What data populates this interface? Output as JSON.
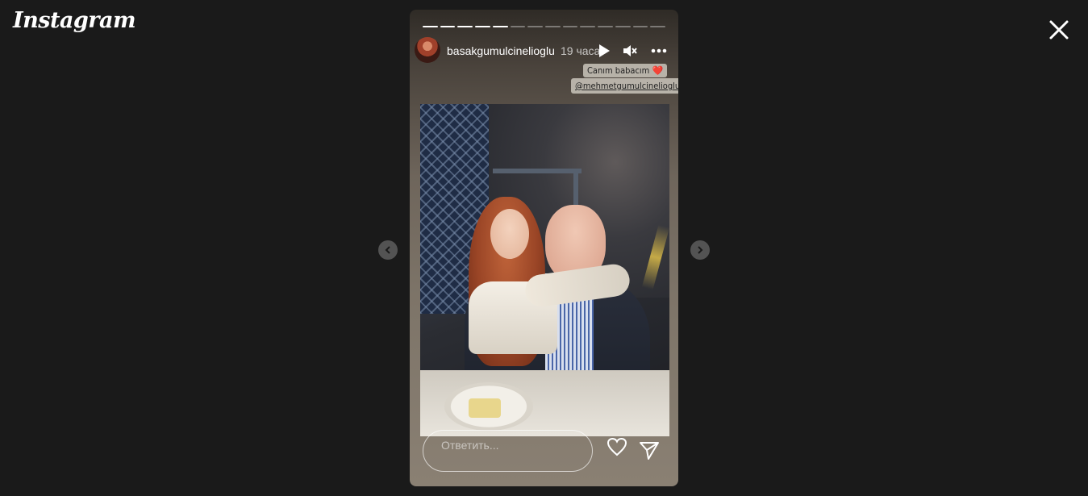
{
  "app": {
    "logo_text": "Instagram"
  },
  "story": {
    "progress": {
      "total_segments": 14,
      "completed_segments": 5
    },
    "author": {
      "username": "basakgumulcinelioglu",
      "time_ago": "19 часа"
    },
    "controls": {
      "play_icon": "play-icon",
      "mute_icon": "muted-speaker-icon",
      "more_icon": "more-dots-icon"
    },
    "caption": {
      "line1": "Canım babacım ❤️",
      "mention": "@mehmetgumulcinelioglu"
    },
    "reply": {
      "placeholder": "Ответить..."
    },
    "actions": {
      "like_icon": "heart-icon",
      "share_icon": "send-icon"
    }
  },
  "navigation": {
    "prev_icon": "chevron-left-icon",
    "next_icon": "chevron-right-icon",
    "close_icon": "close-icon"
  }
}
